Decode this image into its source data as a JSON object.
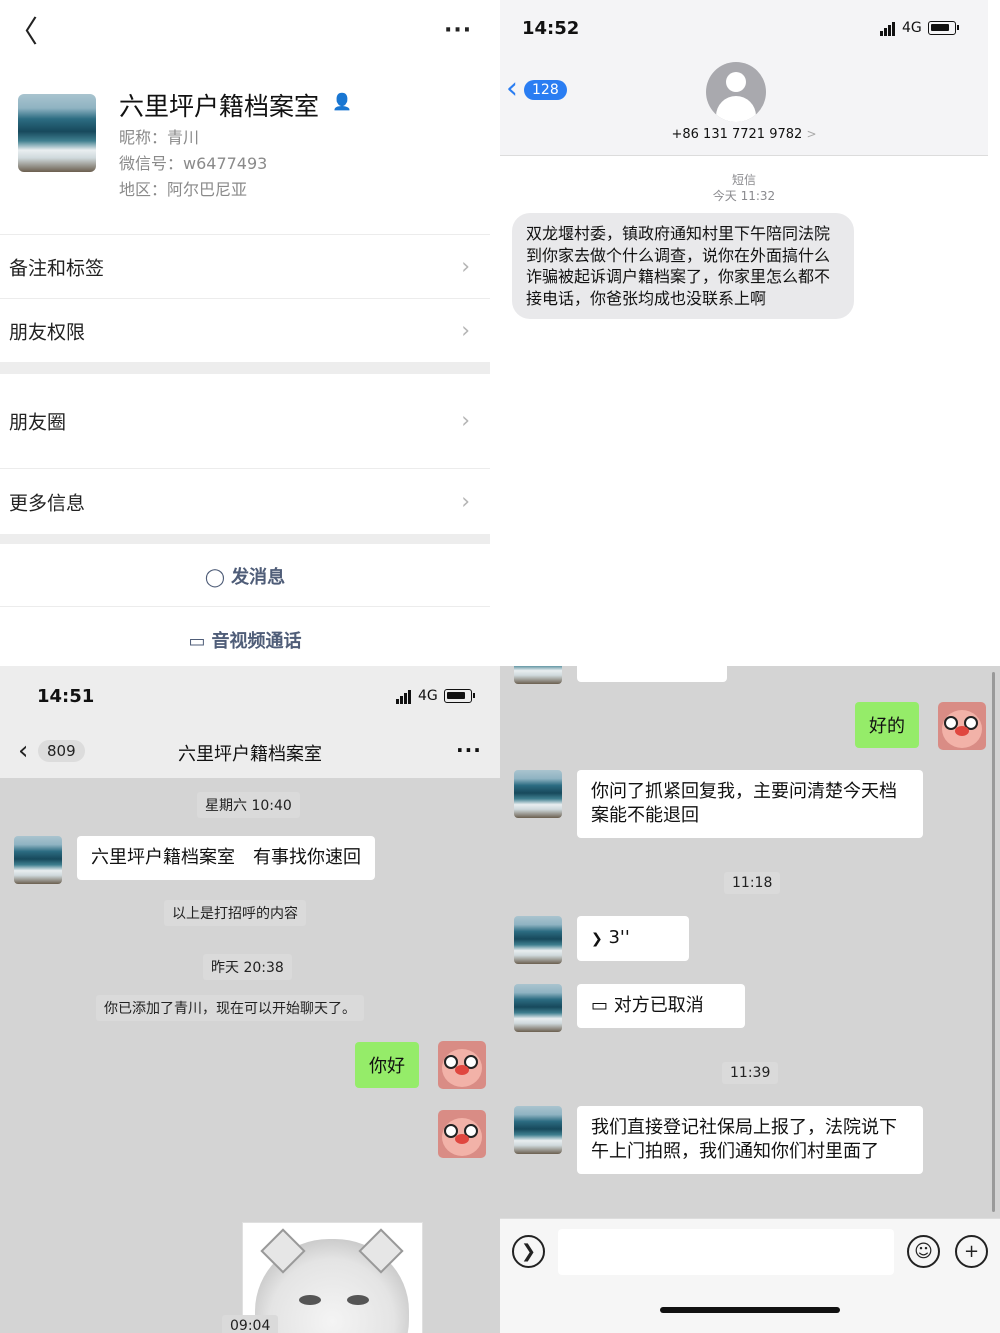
{
  "profile": {
    "name": "六里坪户籍档案室",
    "nickname": "昵称：青川",
    "wechat_id": "微信号：w6477493",
    "region": "地区：阿尔巴尼亚",
    "rows": [
      "备注和标签",
      "朋友权限",
      "朋友圈",
      "更多信息"
    ],
    "send_message": "发消息",
    "av_call": "音视频通话",
    "back": "〈",
    "more": "···",
    "chevron": "›"
  },
  "sms": {
    "time": "14:52",
    "network": "4G",
    "back_badge": "128",
    "phone": "+86 131 7721 9782",
    "kind": "短信",
    "date": "今天 11:32",
    "message": "双龙堰村委，镇政府通知村里下午陪同法院到你家去做个什么调查，说你在外面搞什么诈骗被起诉调户籍档案了，你家里怎么都不接电话，你爸张均成也没联系上啊"
  },
  "chat1": {
    "time": "14:51",
    "network": "4G",
    "unread": "809",
    "title": "六里坪户籍档案室",
    "ts1": "星期六 10:40",
    "greeting": "六里坪户籍档案室　有事找你速回",
    "sys1": "以上是打招呼的内容",
    "ts2": "昨天 20:38",
    "sys2": "你已添加了青川，现在可以开始聊天了。",
    "hello": "你好",
    "ts3": "09:04"
  },
  "chat2": {
    "ok": "好的",
    "msg1": "你问了抓紧回复我，主要问清楚今天档案能不能退回",
    "ts1": "11:18",
    "voice": "3''",
    "call": "对方已取消",
    "ts2": "11:39",
    "msg2": "我们直接登记社保局上报了，法院说下午上门拍照，我们通知你们村里面了"
  },
  "colors": {
    "wechat_green": "#95ec69",
    "ios_blue": "#2a7df2",
    "link_gray_blue": "#4f5d78"
  },
  "icons": [
    "back-icon",
    "more-icon",
    "person-icon",
    "chevron-right-icon",
    "chat-bubble-icon",
    "video-call-icon",
    "voice-icon",
    "emoji-icon",
    "plus-icon",
    "signal-icon",
    "battery-icon"
  ]
}
